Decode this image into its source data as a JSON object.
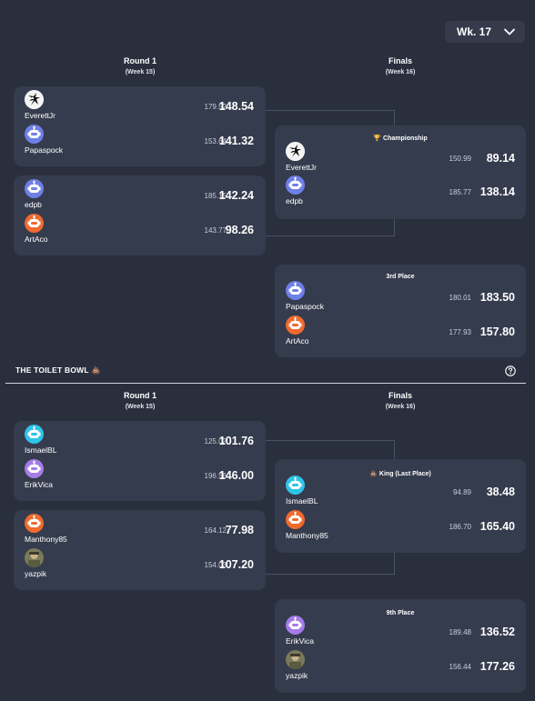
{
  "week_select": {
    "label": "Wk. 17",
    "icon": "chevron-down-icon"
  },
  "winners": {
    "columns": [
      {
        "title": "Round 1",
        "subtitle": "(Week 15)"
      },
      {
        "title": "Finals",
        "subtitle": "(Week 16)"
      }
    ],
    "round1": [
      {
        "teams": [
          {
            "name": "EverettJr",
            "avatar": "skull-avatar",
            "projected": "179.52",
            "score": "148.54"
          },
          {
            "name": "Papaspock",
            "avatar": "robot-avatar",
            "projected": "153.64",
            "score": "141.32"
          }
        ]
      },
      {
        "teams": [
          {
            "name": "edpb",
            "avatar": "robot-avatar",
            "projected": "185.15",
            "score": "142.24"
          },
          {
            "name": "ArtAco",
            "avatar": "robot-avatar",
            "projected": "143.77",
            "score": "98.26"
          }
        ]
      }
    ],
    "finals": [
      {
        "title": "🏆 Championship",
        "teams": [
          {
            "name": "EverettJr",
            "avatar": "skull-avatar",
            "projected": "150.99",
            "score": "89.14"
          },
          {
            "name": "edpb",
            "avatar": "robot-avatar",
            "projected": "185.77",
            "score": "138.14"
          }
        ]
      },
      {
        "title": "3rd Place",
        "teams": [
          {
            "name": "Papaspock",
            "avatar": "robot-avatar",
            "projected": "180.01",
            "score": "183.50"
          },
          {
            "name": "ArtAco",
            "avatar": "robot-avatar",
            "projected": "177.93",
            "score": "157.80"
          }
        ]
      }
    ]
  },
  "toilet": {
    "section_title": "THE TOILET BOWL 💩",
    "help_icon": "question-circle-icon",
    "columns": [
      {
        "title": "Round 1",
        "subtitle": "(Week 15)"
      },
      {
        "title": "Finals",
        "subtitle": "(Week 16)"
      }
    ],
    "round1": [
      {
        "teams": [
          {
            "name": "IsmaelBL",
            "avatar": "robot-avatar",
            "projected": "125.02",
            "score": "101.76"
          },
          {
            "name": "ErikVica",
            "avatar": "robot-avatar",
            "projected": "196.56",
            "score": "146.00"
          }
        ]
      },
      {
        "teams": [
          {
            "name": "Manthony85",
            "avatar": "robot-avatar",
            "projected": "164.12",
            "score": "77.98"
          },
          {
            "name": "yazpik",
            "avatar": "photo-avatar",
            "projected": "154.03",
            "score": "107.20"
          }
        ]
      }
    ],
    "finals": [
      {
        "title": "💩 King (Last Place)",
        "teams": [
          {
            "name": "IsmaelBL",
            "avatar": "robot-avatar",
            "projected": "94.89",
            "score": "38.48"
          },
          {
            "name": "Manthony85",
            "avatar": "robot-avatar",
            "projected": "186.70",
            "score": "165.40"
          }
        ]
      },
      {
        "title": "9th Place",
        "teams": [
          {
            "name": "ErikVica",
            "avatar": "robot-avatar",
            "projected": "189.48",
            "score": "136.52"
          },
          {
            "name": "yazpik",
            "avatar": "photo-avatar",
            "projected": "156.44",
            "score": "177.26"
          }
        ]
      }
    ]
  },
  "colors": {
    "background": "#2a2f3e",
    "card": "#353c4d",
    "avatar_blue": "#6f7fe8",
    "avatar_orange": "#f06a2e",
    "avatar_cyan": "#2ec4e8",
    "avatar_purple": "#a57be8"
  }
}
